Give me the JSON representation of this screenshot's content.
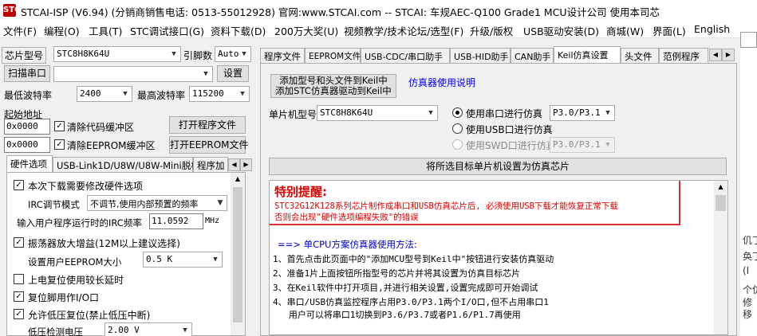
{
  "title": "STCAI-ISP (V6.94) (分销商销售电话: 0513-55012928) 官网:www.STCAI.com  -- STCAI: 车规AEC-Q100 Grade1 MCU设计公司 使用本司芯",
  "title_icon": "STC",
  "menu": [
    "文件(F)",
    "编程(O)",
    "工具(T)",
    "STC调试接口(G)",
    "资料下载(D)",
    "200万大奖(U)",
    "视频教学/技术论坛/选型(F)",
    "升级/版权",
    "USB驱动安装(D)",
    "商城(W)",
    "界面(L)",
    "English"
  ],
  "left": {
    "chip_label": "芯片型号",
    "chip_value": "STC8H8K64U",
    "pin_label": "引脚数",
    "pin_value": "Auto",
    "scan_button": "扫描串口",
    "port_value": "",
    "settings_button": "设置",
    "min_baud_label": "最低波特率",
    "min_baud_value": "2400",
    "max_baud_label": "最高波特率",
    "max_baud_value": "115200",
    "start_addr_label": "起始地址",
    "addr1": "0x0000",
    "clear_code_label": "清除代码缓冲区",
    "open_program_button": "打开程序文件",
    "addr2": "0x0000",
    "clear_eeprom_label": "清除EEPROM缓冲区",
    "open_eeprom_button": "打开EEPROM文件",
    "subtabs": [
      "硬件选项",
      "USB-Link1D/U8W/U8W-Mini脱机",
      "程序加"
    ],
    "options": {
      "opt1": "本次下载需要修改硬件选项",
      "irc_label": "IRC调节模式",
      "irc_value": "不调节,使用内部预置的频率",
      "freq_label": "输入用户程序运行时的IRC频率",
      "freq_value": "11.0592",
      "freq_unit": "MHz",
      "opt2": "振荡器放大增益(12M以上建议选择)",
      "eeprom_size_label": "设置用户EEPROM大小",
      "eeprom_size_value": "0.5 K",
      "opt3": "上电复位使用较长延时",
      "opt4": "复位脚用作I/O口",
      "opt5": "允许低压复位(禁止低压中断)",
      "lv_label": "低压检测电压",
      "lv_value": "2.00 V"
    }
  },
  "right": {
    "tabs": [
      "程序文件",
      "EEPROM文件",
      "USB-CDC/串口助手",
      "USB-HID助手",
      "CAN助手",
      "Keil仿真设置",
      "头文件",
      "范例程序"
    ],
    "selected_tab_index": 5,
    "add_button_line1": "添加型号和头文件到Keil中",
    "add_button_line2": "添加STC仿真器驱动到Keil中",
    "emu_help_link": "仿真器使用说明",
    "mcu_label": "单片机型号",
    "mcu_value": "STC8H8K64U",
    "radio_serial": "使用串口进行仿真",
    "serial_port": "P3.0/P3.1",
    "radio_usb": "使用USB口进行仿真",
    "radio_swd": "使用SWD口进行仿真",
    "swd_port": "P3.0/P3.1",
    "set_chip_button": "将所选目标单片机设置为仿真芯片",
    "notice_title": "特别提醒:",
    "notice_line1": "STC32G12K128系列芯片制作成串口和USB仿真芯片后, 必须使用USB下载才能恢复正常下载",
    "notice_line2": "否则会出现\"硬件选项编程失败\"的错误",
    "howto_title": "==> 单CPU方案仿真器使用方法:",
    "steps": [
      "1、首先点击此页面中的\"添加MCU型号到Keil中\"按钮进行安装仿真驱动",
      "2、准备1片上面按钮所指型号的芯片并将其设置为仿真目标芯片",
      "3、在Keil软件中打开项目,并进行相关设置,设置完成即可开始调试",
      "4、串口/USB仿真监控程序占用P3.0/P3.1两个I/O口,但不占用串口1",
      "   用户可以将串口1切换到P3.6/P3.7或者P1.6/P1.7再使用"
    ]
  },
  "right_strip": [
    "仉丁",
    "奂丁",
    "(I",
    "个仿",
    "修",
    "移"
  ],
  "colors": {
    "accent_red": "#e00000",
    "link_blue": "#0000ff",
    "notice_border": "#e03030"
  }
}
